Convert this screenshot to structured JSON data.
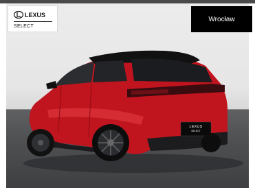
{
  "brand": {
    "logo_text": "LEXUS",
    "subtitle": "SELECT"
  },
  "location": {
    "city_label": "Wrocław"
  },
  "photo": {
    "plate_logo_text": "LEXUS",
    "plate_sub_text": "SELECT"
  },
  "colors": {
    "car_body": "#c0141e",
    "roof": "#111111",
    "button_bg": "#000000",
    "floor": "#4f5052"
  }
}
